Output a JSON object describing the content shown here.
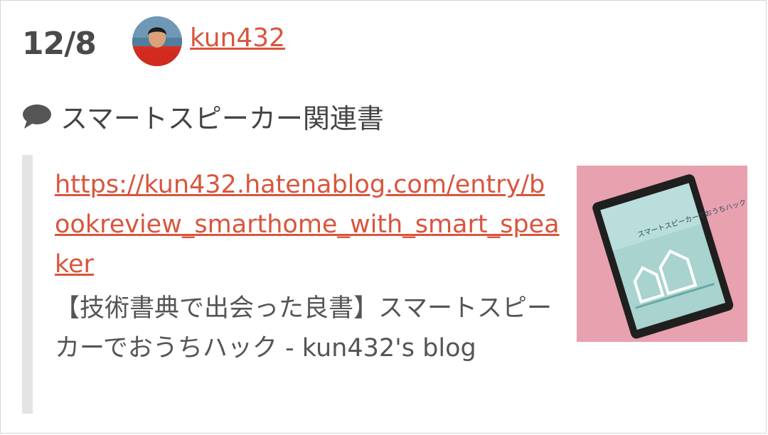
{
  "entry": {
    "date": "12/8",
    "username": "kun432"
  },
  "comment": {
    "icon": "speech-bubble-icon",
    "text": "スマートスピーカー関連書"
  },
  "embed": {
    "url": "https://kun432.hatenablog.com/entry/bookreview_smarthome_with_smart_speaker",
    "title": "【技術書典で出会った良書】スマートスピーカーでおうちハック - kun432's blog",
    "thumbnail": {
      "screen_text": "スマートスピーカーでおうちハック"
    }
  },
  "colors": {
    "link": "#d9553d",
    "text": "#444444",
    "quote_bar": "#e4e4e4",
    "thumb_bg": "#e9a3b1"
  }
}
